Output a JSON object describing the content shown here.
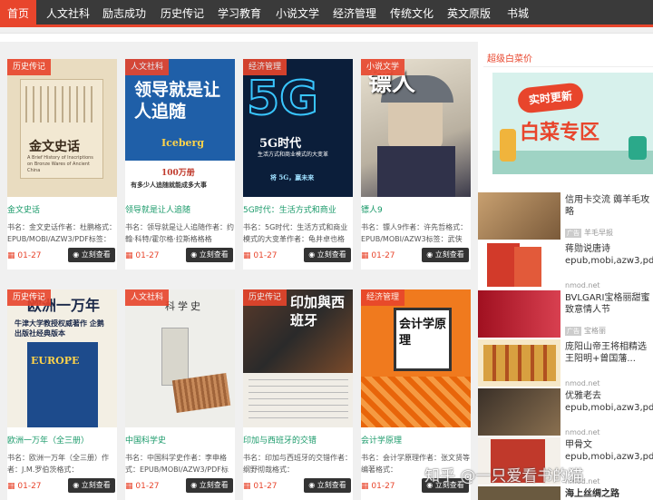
{
  "nav": {
    "items": [
      "首页",
      "人文社科",
      "励志成功",
      "历史传记",
      "学习教育",
      "小说文学",
      "经济管理",
      "传统文化",
      "英文原版",
      "书城"
    ]
  },
  "books": [
    {
      "category": "历史传记",
      "title": "金文史话",
      "desc": "书名：金文史话作者：杜鹏格式：EPUB/MOBI/AZW3/PDF标签：",
      "date": "01-27",
      "button": "立刻查看",
      "cover_title": "金文史话",
      "cover_sub": "A Brief History of Inscriptions on Bronze Wares of Ancient China"
    },
    {
      "category": "人文社科",
      "title": "领导就是让人追随",
      "desc": "书名：领导就是让人追随作者：约翰·科特/霍尔格·拉斯格格格",
      "date": "01-27",
      "button": "立刻查看",
      "cover_title": "领导就是让人追随",
      "cover_sub": "Iceberg",
      "cover_tag": "100万册",
      "cover_tag2": "有多少人追随就能成多大事"
    },
    {
      "category": "经济管理",
      "title": "5G时代：生活方式和商业",
      "desc": "书名：5G时代：生活方式和商业模式的大变革作者：龟井卓也格",
      "date": "01-27",
      "button": "立刻查看",
      "cover_title": "5G时代",
      "cover_sub": "生活方式和商业模式的大变革",
      "cover_tag": "将 5G，赢未来"
    },
    {
      "category": "小说文学",
      "title": "镖人9",
      "desc": "书名：镖人9作者：许先哲格式：EPUB/MOBI/AZW3标签：武侠",
      "date": "01-27",
      "button": "立刻查看",
      "cover_title": "镖人"
    },
    {
      "category": "历史传记",
      "title": "欧洲一万年（全三册）",
      "desc": "书名：欧洲一万年（全三册）作者：J.M.罗伯茨格式：",
      "date": "01-27",
      "button": "立刻查看",
      "cover_title": "欧洲一万年",
      "cover_sub": "牛津大学教授权威著作 企鹅出版社经典版本",
      "cover_tag": "EUROPE"
    },
    {
      "category": "人文社科",
      "title": "中国科学史",
      "desc": "书名：中国科学史作者：李申格式：EPUB/MOBI/AZW3/PDF标",
      "date": "01-27",
      "button": "立刻查看",
      "cover_title": "科学史"
    },
    {
      "category": "历史传记",
      "title": "印加与西班牙的交错",
      "desc": "书名：印加与西班牙的交错作者：纲野彻哉格式：",
      "date": "01-27",
      "button": "立刻查看",
      "cover_title": "印加與西班牙"
    },
    {
      "category": "经济管理",
      "title": "会计学原理",
      "desc": "书名：会计学原理作者：张文贤等编著格式：",
      "date": "01-27",
      "button": "立刻查看",
      "cover_title": "会计学原理"
    }
  ],
  "sidebar": {
    "title": "超级白菜价",
    "banner": {
      "line1": "实时更新",
      "line2": "白菜专区"
    },
    "items": [
      {
        "text": "信用卡交流 薅羊毛攻略",
        "source": "羊毛早报",
        "tag": "广告"
      },
      {
        "text": "蒋勋说唐诗 epub,mobi,azw3,pdf",
        "source": "nmod.net"
      },
      {
        "text": "BVLGARI宝格丽甜蜜致意情人节",
        "source": "宝格丽",
        "tag": "广告"
      },
      {
        "text": "庞阳山帝王将相精选 王阳明+曾国藩...",
        "source": "nmod.net"
      },
      {
        "text": "优雅老去 epub,mobi,azw3,pdf",
        "source": "nmod.net"
      },
      {
        "text": "甲骨文 epub,mobi,azw3,pdf",
        "source": "nmod.net"
      },
      {
        "text": "海上丝绸之路",
        "source": ""
      }
    ]
  },
  "watermark": "知乎 @一只爱看书的猫"
}
